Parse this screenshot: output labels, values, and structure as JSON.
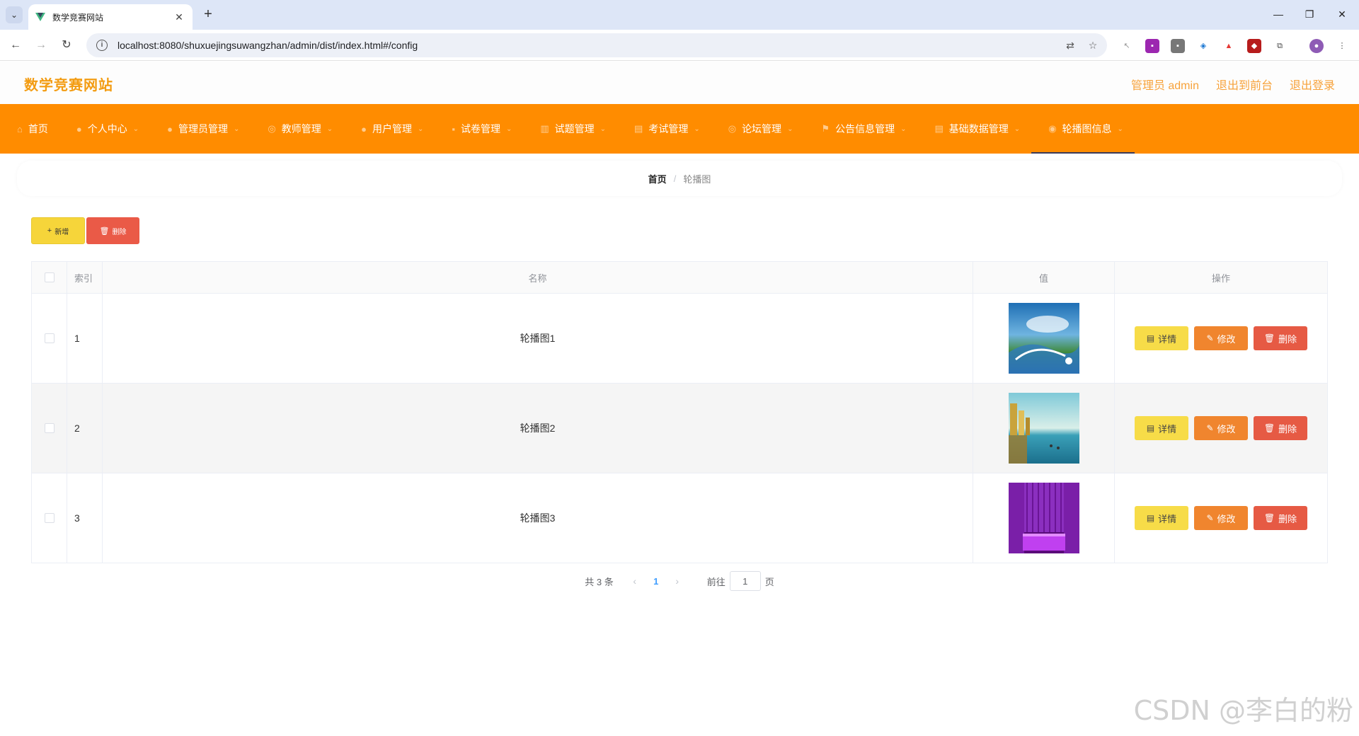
{
  "browser": {
    "tab_title": "数学竞赛网站",
    "url": "localhost:8080/shuxuejingsuwangzhan/admin/dist/index.html#/config"
  },
  "header": {
    "site_title": "数学竞赛网站",
    "admin_label": "管理员 admin",
    "front_link": "退出到前台",
    "logout_link": "退出登录"
  },
  "menu": [
    {
      "label": "首页",
      "icon": "home-icon"
    },
    {
      "label": "个人中心",
      "icon": "user-icon"
    },
    {
      "label": "管理员管理",
      "icon": "user-icon"
    },
    {
      "label": "教师管理",
      "icon": "circle-icon"
    },
    {
      "label": "用户管理",
      "icon": "user-icon"
    },
    {
      "label": "试卷管理",
      "icon": "chat-icon"
    },
    {
      "label": "试题管理",
      "icon": "chart-icon"
    },
    {
      "label": "考试管理",
      "icon": "doc-icon"
    },
    {
      "label": "论坛管理",
      "icon": "circle-icon"
    },
    {
      "label": "公告信息管理",
      "icon": "flag-icon"
    },
    {
      "label": "基础数据管理",
      "icon": "doc-icon"
    },
    {
      "label": "轮播图信息",
      "icon": "pin-icon"
    }
  ],
  "breadcrumb": {
    "home": "首页",
    "sep": "/",
    "current": "轮播图"
  },
  "toolbar": {
    "add_label": "新增",
    "delete_label": "删除"
  },
  "table": {
    "headers": {
      "index": "索引",
      "name": "名称",
      "value": "值",
      "actions": "操作"
    },
    "rows": [
      {
        "index": "1",
        "name": "轮播图1"
      },
      {
        "index": "2",
        "name": "轮播图2"
      },
      {
        "index": "3",
        "name": "轮播图3"
      }
    ],
    "actions": {
      "detail": "详情",
      "edit": "修改",
      "delete": "删除"
    }
  },
  "pagination": {
    "total": "共 3 条",
    "current": "1",
    "goto_prefix": "前往",
    "goto_value": "1",
    "goto_suffix": "页"
  },
  "watermark": "CSDN @李白的粉",
  "colors": {
    "brand": "#ff8c00",
    "title": "#f39c12",
    "add": "#f6d53a",
    "danger": "#ea5a47",
    "edit": "#f0852e"
  }
}
